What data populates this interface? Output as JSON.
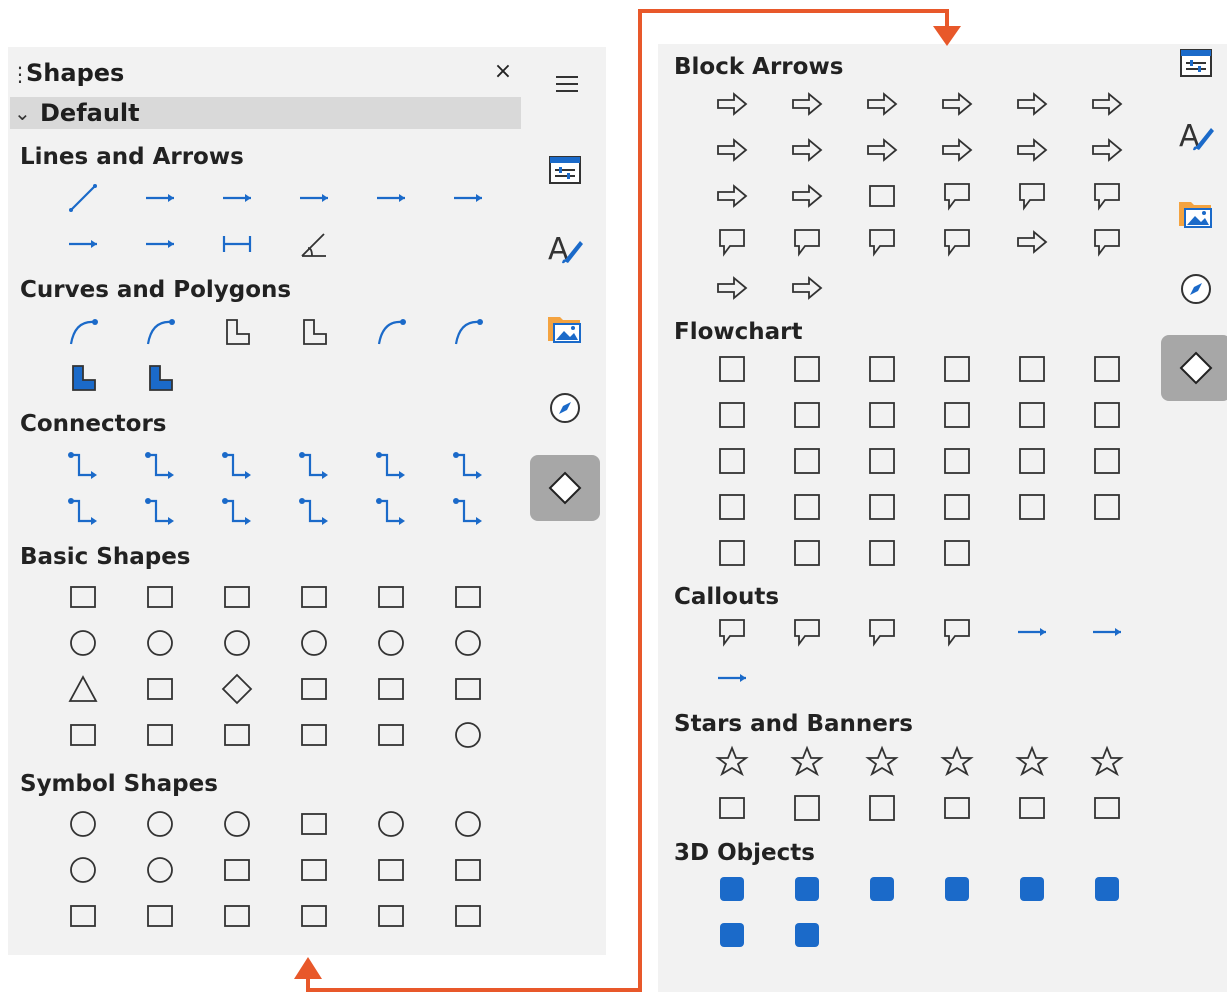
{
  "left": {
    "title": "Shapes",
    "close": "×",
    "group": "Default",
    "sections": [
      {
        "title": "Lines and Arrows",
        "icons": [
          "line",
          "line-arrow",
          "line-circle-arrow",
          "line-square-arrow",
          "line-arrows-both",
          "line-arrow-left",
          "line-circle-left",
          "line-square-left",
          "dimension-line",
          "angle-line"
        ]
      },
      {
        "title": "Curves and Polygons",
        "icons": [
          "curve",
          "bezier",
          "polygon-45",
          "polyline",
          "curve-filled",
          "bezier-filled",
          "polygon-filled",
          "polyline-filled"
        ]
      },
      {
        "title": "Connectors",
        "icons": [
          "connector-std",
          "connector-line",
          "connector-curved",
          "connector-std-arrows",
          "connector-std-ends",
          "connector-line-ends",
          "connector-curved-ends",
          "connector-std-circles",
          "connector-arrows-start",
          "connector-line-circles",
          "connector-curved-both",
          "connector-arrows-end"
        ]
      },
      {
        "title": "Basic Shapes",
        "icons": [
          "rectangle",
          "rounded-rectangle",
          "square",
          "rounded-square",
          "parallelogram",
          "trapezoid",
          "ellipse",
          "circle",
          "circle-pie",
          "octagon-circle",
          "arc",
          "block-arc",
          "triangle",
          "right-triangle",
          "diamond",
          "pentagon",
          "hexagon",
          "octagon",
          "cross",
          "cylinder",
          "cube",
          "folded-corner",
          "frame",
          "ring"
        ]
      },
      {
        "title": "Symbol Shapes",
        "icons": [
          "smiley",
          "sun",
          "moon",
          "lightning",
          "heart",
          "flower",
          "cloud",
          "forbidden",
          "puzzle",
          "double-bracket",
          "left-bracket",
          "right-bracket",
          "double-brace",
          "left-brace",
          "right-brace",
          "square-bevel",
          "octagon-bevel",
          "diamond-bevel"
        ]
      }
    ]
  },
  "right": {
    "sections": [
      {
        "title": "Block Arrows",
        "icons": [
          "left-arrow",
          "right-arrow",
          "up-arrow",
          "down-arrow",
          "left-right-arrow",
          "up-down-arrow",
          "up-right-arrow",
          "up-right-down-arrow",
          "four-way-arrow",
          "corner-right-arrow",
          "split-arrow",
          "striped-right-arrow",
          "notched-right-arrow",
          "pentagon-arrow",
          "chevron",
          "right-arrow-callout",
          "left-arrow-callout",
          "up-arrow-callout",
          "left-right-callout",
          "up-down-callout",
          "up-right-callout",
          "four-way-callout",
          "circular-arrow",
          "down-arrow-callout",
          "split-round-arrow",
          "s-shaped-arrow"
        ]
      },
      {
        "title": "Flowchart",
        "icons": [
          "fc-process",
          "fc-alt-process",
          "fc-decision",
          "fc-data",
          "fc-predefined",
          "fc-internal-storage",
          "fc-document",
          "fc-multidocument",
          "fc-terminator",
          "fc-preparation",
          "fc-manual-input",
          "fc-manual-operation",
          "fc-connector",
          "fc-offpage",
          "fc-card",
          "fc-punched-tape",
          "fc-summing",
          "fc-or",
          "fc-collate",
          "fc-sort",
          "fc-extract",
          "fc-merge",
          "fc-stored-data",
          "fc-delay",
          "fc-sequential",
          "fc-magnetic-disc",
          "fc-direct-access",
          "fc-display"
        ]
      },
      {
        "title": "Callouts",
        "icons": [
          "rect-callout",
          "rounded-rect-callout",
          "round-callout",
          "cloud-callout",
          "line-callout-1",
          "line-callout-2",
          "line-callout-3"
        ]
      },
      {
        "title": "Stars and Banners",
        "icons": [
          "star-4",
          "star-5",
          "star-6",
          "star-8",
          "star-12",
          "star-24",
          "explosion",
          "vertical-scroll",
          "horizontal-scroll",
          "signet",
          "doorplate",
          "concave-star"
        ]
      },
      {
        "title": "3D Objects",
        "icons": [
          "cube-3d",
          "sphere-3d",
          "cylinder-3d",
          "cone-3d",
          "pyramid-3d",
          "torus-3d",
          "shell-3d",
          "half-sphere-3d"
        ]
      }
    ]
  },
  "sidebar_left": [
    "menu-icon",
    "properties-icon",
    "styles-icon",
    "gallery-icon",
    "navigator-icon",
    "shapes-icon"
  ],
  "colors": {
    "accent": "#1b6ac9",
    "orange": "#e8582a",
    "panel": "#f2f2f2",
    "active": "#a7a7a7"
  }
}
